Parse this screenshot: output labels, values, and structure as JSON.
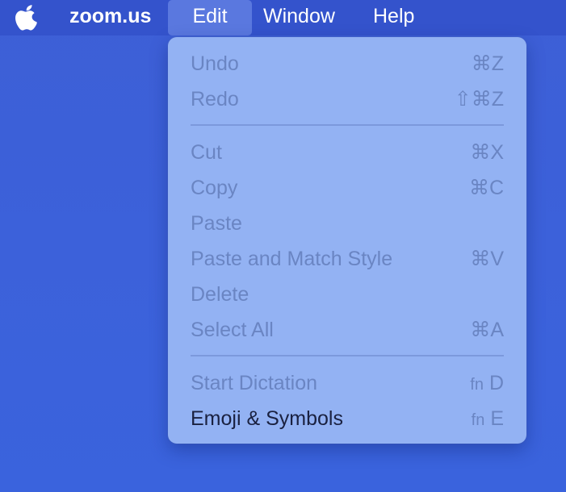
{
  "menubar": {
    "apple_icon": "apple-logo-icon",
    "app_name": "zoom.us",
    "menus": [
      "Edit",
      "Window",
      "Help"
    ]
  },
  "edit_menu": {
    "items": [
      {
        "label": "Undo",
        "shortcut": "⌘Z",
        "enabled": false
      },
      {
        "label": "Redo",
        "shortcut": "⇧⌘Z",
        "enabled": false
      },
      {
        "label": "Cut",
        "shortcut": "⌘X",
        "enabled": false
      },
      {
        "label": "Copy",
        "shortcut": "⌘C",
        "enabled": false
      },
      {
        "label": "Paste",
        "shortcut": "",
        "enabled": false
      },
      {
        "label": "Paste and Match Style",
        "shortcut": "⌘V",
        "enabled": false
      },
      {
        "label": "Delete",
        "shortcut": "",
        "enabled": false
      },
      {
        "label": "Select All",
        "shortcut": "⌘A",
        "enabled": false
      },
      {
        "label": "Start Dictation",
        "shortcut_prefix": "fn",
        "shortcut": "D",
        "enabled": false
      },
      {
        "label": "Emoji & Symbols",
        "shortcut_prefix": "fn",
        "shortcut": "E",
        "enabled": true
      }
    ]
  },
  "colors": {
    "desktop": "#3c61da",
    "menubar": "#3453cc",
    "menu_background": "#93b2f3",
    "disabled_text": "#6a85c3",
    "enabled_text": "#1a2140"
  }
}
